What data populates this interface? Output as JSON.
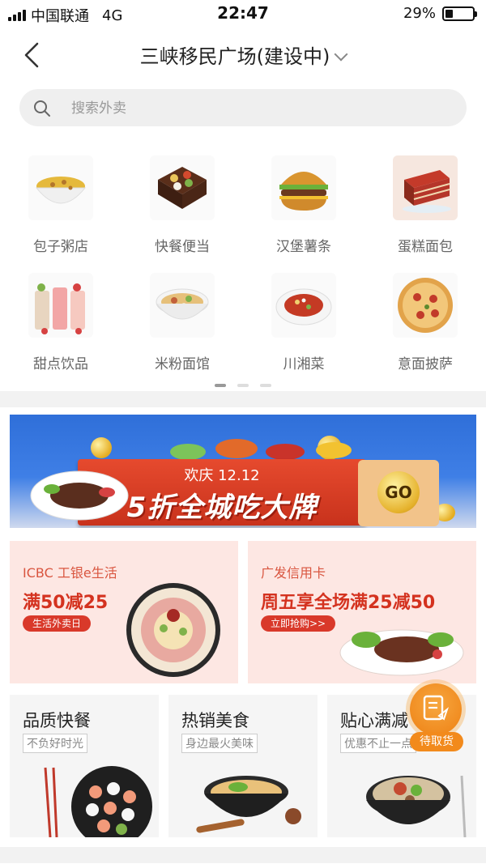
{
  "status_bar": {
    "carrier": "中国联通",
    "network": "4G",
    "time": "22:47",
    "battery_percent": "29%",
    "battery_level": 0.29
  },
  "nav": {
    "title": "三峡移民广场(建设中)"
  },
  "search": {
    "placeholder": "搜索外卖"
  },
  "categories": [
    {
      "label": "包子粥店",
      "icon": "porridge-bowl"
    },
    {
      "label": "快餐便当",
      "icon": "bento-box"
    },
    {
      "label": "汉堡薯条",
      "icon": "burger"
    },
    {
      "label": "蛋糕面包",
      "icon": "cake"
    },
    {
      "label": "甜点饮品",
      "icon": "drinks"
    },
    {
      "label": "米粉面馆",
      "icon": "noodle-bowl"
    },
    {
      "label": "川湘菜",
      "icon": "spicy-dish"
    },
    {
      "label": "意面披萨",
      "icon": "pizza"
    }
  ],
  "pager": {
    "pages": 3,
    "current": 1
  },
  "banner": {
    "subtitle": "欢庆 12.12",
    "headline": "5折全城吃大牌",
    "go_label": "GO"
  },
  "promos": [
    {
      "brand": "ICBC 工银e生活",
      "offer": "满50减25",
      "tag": "生活外卖日"
    },
    {
      "brand": "广发信用卡",
      "offer": "周五享全场满25减50",
      "tag": "立即抢购>>"
    }
  ],
  "features": [
    {
      "title": "品质快餐",
      "subtitle": "不负好时光"
    },
    {
      "title": "热销美食",
      "subtitle": "身边最火美味"
    },
    {
      "title": "贴心满减",
      "subtitle": "优惠不止一点"
    }
  ],
  "fab": {
    "label": "待取货"
  },
  "colors": {
    "accent": "#f08a1e",
    "promo_red": "#d4321f",
    "banner_blue": "#2f6fd9"
  }
}
